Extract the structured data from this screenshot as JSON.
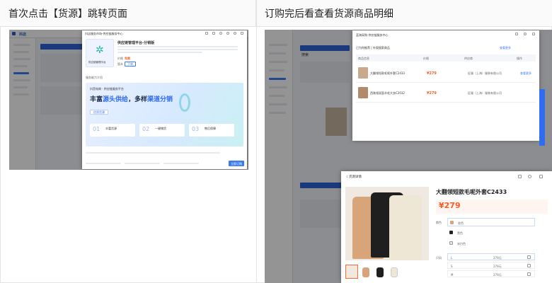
{
  "left_panel": {
    "caption": "首次点击【货源】跳转页面",
    "app_logo": "抖店",
    "modal": {
      "title": "抖店服务市场-供应链服务中心",
      "service_name": "供应链管理平台-分销版",
      "store_name": "供应链管理平台",
      "price_label": "价格",
      "price_value": "免费",
      "version_label": "版本",
      "version_value": "下单",
      "section_label": "服务能力介绍",
      "banner_brand": "抖音电商 · 供应链服务平台",
      "banner_headline_a": "丰富",
      "banner_headline_b": "源头供给",
      "banner_headline_c": "，多样",
      "banner_headline_d": "渠道分销",
      "step_card_1": "优质货源",
      "step_1": "01",
      "step_label_1": "丰富货源",
      "step_2": "02",
      "step_label_2": "一键铺货",
      "step_3": "03",
      "step_label_3": "售后保障",
      "confirm_button": "立即订购"
    }
  },
  "right_panel": {
    "caption": "订购完后看查看货源商品明细",
    "sidebar_search": "搜索",
    "top_modal": {
      "title": "蓝海采购-供应链服务中心",
      "tab": "已为你推荐 | 外观搜索商品",
      "col_product": "商品信息",
      "col_price": "价格",
      "col_supplier": "供应商",
      "col_action": "操作",
      "rows": [
        {
          "name": "大翻领短款毛呢外套C2433",
          "price": "¥279",
          "supplier": "征服（上海）服装有限公司"
        },
        {
          "name": "西装领双面羊毛大衣C2032",
          "price": "¥279",
          "supplier": "征服（上海）服装有限公司"
        }
      ],
      "link_text": "查看更多"
    },
    "detail_modal": {
      "back": "〈 货源详情",
      "product_title": "大翻领短款毛呢外套C2433",
      "price": "¥279",
      "color_label": "颜色",
      "colors": [
        "驼色",
        "黑色",
        "米白色"
      ],
      "size_label": "尺码",
      "sizes": [
        {
          "size": "L",
          "price": "279元"
        },
        {
          "size": "S",
          "price": "279元"
        },
        {
          "size": "M",
          "price": "279元"
        }
      ]
    }
  }
}
